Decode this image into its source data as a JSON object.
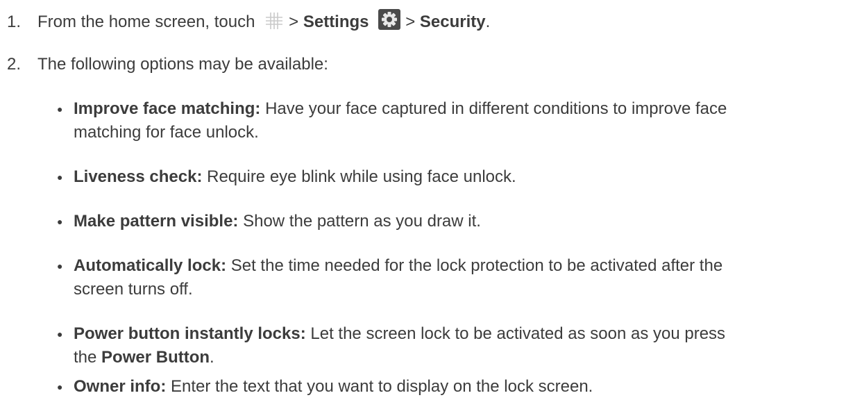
{
  "steps": [
    {
      "number": "1.",
      "parts": {
        "a": "From the home screen, touch",
        "b": ">",
        "settings": "Settings",
        "c": ">",
        "security": "Security",
        "end": "."
      },
      "icons": [
        "apps-grid-icon",
        "settings-gear-icon"
      ]
    },
    {
      "number": "2.",
      "text": "The following options may be available:"
    }
  ],
  "options": [
    {
      "title": "Improve face matching:",
      "desc_line1": "Have your face captured in different conditions to improve face",
      "desc_line2": "matching for face unlock."
    },
    {
      "title": "Liveness check:",
      "desc": "Require eye blink while using face unlock."
    },
    {
      "title": "Make pattern visible:",
      "desc": "Show the pattern as you draw it."
    },
    {
      "title": "Automatically lock:",
      "desc_line1": "Set the time needed for the lock protection to be activated after the",
      "desc_line2": "screen turns off."
    },
    {
      "title": "Power button instantly locks:",
      "desc_line1": "Let the screen lock to be activated as soon as you press",
      "desc_line2_a": "the",
      "desc_line2_bold": "Power Button",
      "desc_line2_end": "."
    },
    {
      "title": "Owner info:",
      "desc": "Enter the text that you want to display on the lock screen."
    }
  ]
}
